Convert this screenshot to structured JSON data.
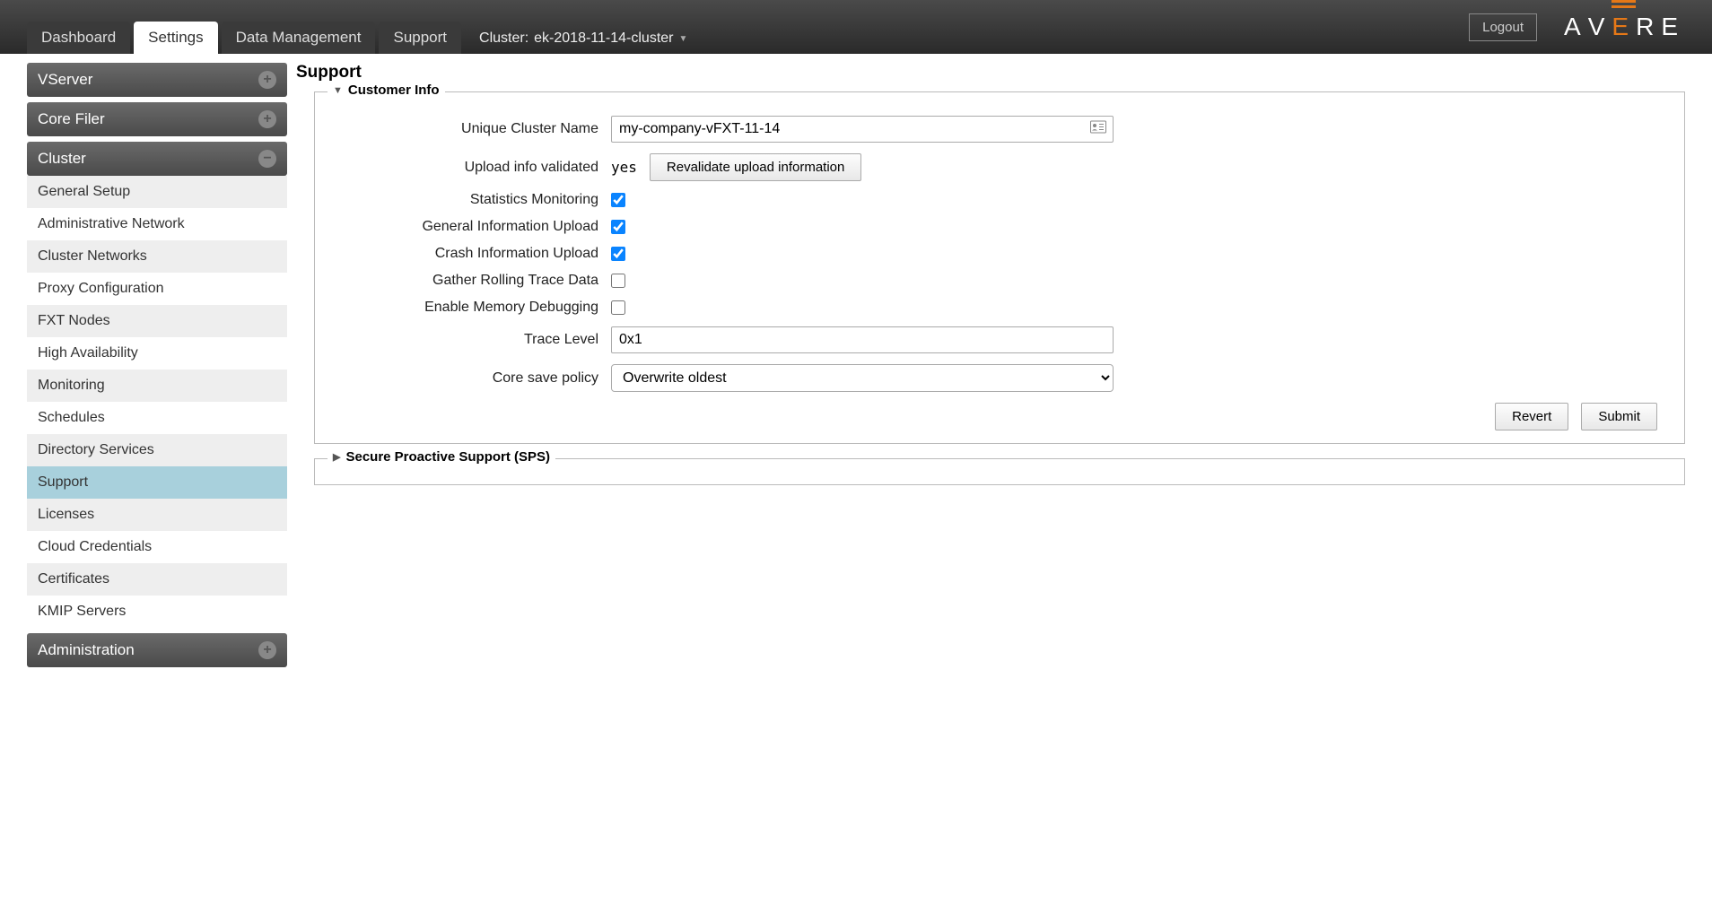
{
  "topbar": {
    "logout": "Logout",
    "logo_letters": [
      "A",
      "V",
      "E",
      "R",
      "E"
    ],
    "tabs": [
      {
        "label": "Dashboard"
      },
      {
        "label": "Settings",
        "active": true
      },
      {
        "label": "Data Management"
      },
      {
        "label": "Support"
      }
    ],
    "cluster_prefix": "Cluster:",
    "cluster_name": "ek-2018-11-14-cluster"
  },
  "sidebar": {
    "sections": [
      {
        "title": "VServer",
        "expanded": false,
        "items": []
      },
      {
        "title": "Core Filer",
        "expanded": false,
        "items": []
      },
      {
        "title": "Cluster",
        "expanded": true,
        "items": [
          "General Setup",
          "Administrative Network",
          "Cluster Networks",
          "Proxy Configuration",
          "FXT Nodes",
          "High Availability",
          "Monitoring",
          "Schedules",
          "Directory Services",
          "Support",
          "Licenses",
          "Cloud Credentials",
          "Certificates",
          "KMIP Servers"
        ],
        "selected": "Support"
      },
      {
        "title": "Administration",
        "expanded": false,
        "items": []
      }
    ]
  },
  "content": {
    "page_title": "Support",
    "customer_info": {
      "legend": "Customer Info",
      "unique_cluster_name_label": "Unique Cluster Name",
      "unique_cluster_name_value": "my-company-vFXT-11-14",
      "upload_validated_label": "Upload info validated",
      "upload_validated_value": "yes",
      "revalidate_button": "Revalidate upload information",
      "statistics_monitoring_label": "Statistics Monitoring",
      "statistics_monitoring_checked": true,
      "general_info_upload_label": "General Information Upload",
      "general_info_upload_checked": true,
      "crash_info_upload_label": "Crash Information Upload",
      "crash_info_upload_checked": true,
      "rolling_trace_label": "Gather Rolling Trace Data",
      "rolling_trace_checked": false,
      "memory_debugging_label": "Enable Memory Debugging",
      "memory_debugging_checked": false,
      "trace_level_label": "Trace Level",
      "trace_level_value": "0x1",
      "core_save_policy_label": "Core save policy",
      "core_save_policy_value": "Overwrite oldest",
      "revert_button": "Revert",
      "submit_button": "Submit"
    },
    "sps": {
      "legend": "Secure Proactive Support (SPS)"
    }
  }
}
